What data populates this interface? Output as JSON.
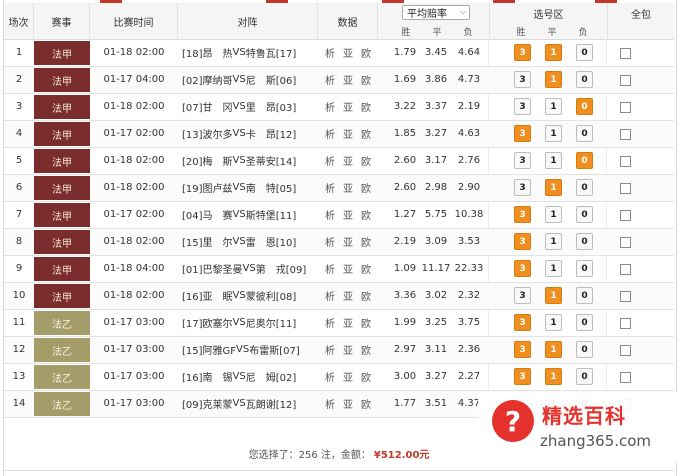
{
  "header": {
    "idx": "场次",
    "league": "赛事",
    "time": "比赛时间",
    "match": "对阵",
    "data": "数据",
    "odds_select": "平均赔率",
    "odds_win": "胜",
    "odds_draw": "平",
    "odds_lose": "负",
    "pick_area": "选号区",
    "pick_win": "胜",
    "pick_draw": "平",
    "pick_lose": "负",
    "all": "全包"
  },
  "links": {
    "analysis": "析",
    "asia": "亚",
    "euro": "欧"
  },
  "colors": {
    "league_jia": "#7b2d2d",
    "league_yi": "#a59d69",
    "selected": "#ef8f1f"
  },
  "rows": [
    {
      "idx": "1",
      "league": "法甲",
      "time": "01-18 02:00",
      "home": "[18]昂　热",
      "vs": "VS",
      "away": "特鲁瓦[17]",
      "w": "1.79",
      "d": "3.45",
      "l": "4.64",
      "sel": [
        1,
        1,
        0
      ],
      "type": "jia"
    },
    {
      "idx": "2",
      "league": "法甲",
      "time": "01-17 04:00",
      "home": "[02]摩纳哥",
      "vs": "VS",
      "away": "尼　斯[06]",
      "w": "1.69",
      "d": "3.86",
      "l": "4.73",
      "sel": [
        0,
        1,
        0
      ],
      "type": "jia"
    },
    {
      "idx": "3",
      "league": "法甲",
      "time": "01-18 02:00",
      "home": "[07]甘　冈",
      "vs": "VS",
      "away": "里　昂[03]",
      "w": "3.22",
      "d": "3.37",
      "l": "2.19",
      "sel": [
        0,
        0,
        1
      ],
      "type": "jia"
    },
    {
      "idx": "4",
      "league": "法甲",
      "time": "01-17 02:00",
      "home": "[13]波尔多",
      "vs": "VS",
      "away": "卡　昂[12]",
      "w": "1.85",
      "d": "3.27",
      "l": "4.63",
      "sel": [
        1,
        0,
        0
      ],
      "type": "jia"
    },
    {
      "idx": "5",
      "league": "法甲",
      "time": "01-18 02:00",
      "home": "[20]梅　斯",
      "vs": "VS",
      "away": "圣蒂安[14]",
      "w": "2.60",
      "d": "3.17",
      "l": "2.76",
      "sel": [
        0,
        0,
        1
      ],
      "type": "jia"
    },
    {
      "idx": "6",
      "league": "法甲",
      "time": "01-18 02:00",
      "home": "[19]图卢兹",
      "vs": "VS",
      "away": "南　特[05]",
      "w": "2.60",
      "d": "2.98",
      "l": "2.90",
      "sel": [
        0,
        1,
        0
      ],
      "type": "jia"
    },
    {
      "idx": "7",
      "league": "法甲",
      "time": "01-17 02:00",
      "home": "[04]马　赛",
      "vs": "VS",
      "away": "斯特堡[11]",
      "w": "1.27",
      "d": "5.75",
      "l": "10.38",
      "sel": [
        1,
        0,
        0
      ],
      "type": "jia"
    },
    {
      "idx": "8",
      "league": "法甲",
      "time": "01-18 02:00",
      "home": "[15]里　尔",
      "vs": "VS",
      "away": "雷　恩[10]",
      "w": "2.19",
      "d": "3.09",
      "l": "3.53",
      "sel": [
        1,
        0,
        0
      ],
      "type": "jia"
    },
    {
      "idx": "9",
      "league": "法甲",
      "time": "01-18 04:00",
      "home": "[01]巴黎圣曼",
      "vs": "VS",
      "away": "第　戎[09]",
      "w": "1.09",
      "d": "11.17",
      "l": "22.33",
      "sel": [
        1,
        0,
        0
      ],
      "type": "jia"
    },
    {
      "idx": "10",
      "league": "法甲",
      "time": "01-18 02:00",
      "home": "[16]亚　眠",
      "vs": "VS",
      "away": "蒙彼利[08]",
      "w": "3.36",
      "d": "3.02",
      "l": "2.32",
      "sel": [
        0,
        1,
        0
      ],
      "type": "jia"
    },
    {
      "idx": "11",
      "league": "法乙",
      "time": "01-17 03:00",
      "home": "[17]欧塞尔",
      "vs": "VS",
      "away": "尼奥尔[11]",
      "w": "1.99",
      "d": "3.25",
      "l": "3.75",
      "sel": [
        1,
        0,
        0
      ],
      "type": "yi"
    },
    {
      "idx": "12",
      "league": "法乙",
      "time": "01-17 03:00",
      "home": "[15]阿雅GF",
      "vs": "VS",
      "away": "布雷斯[07]",
      "w": "2.97",
      "d": "3.11",
      "l": "2.36",
      "sel": [
        1,
        1,
        0
      ],
      "type": "yi"
    },
    {
      "idx": "13",
      "league": "法乙",
      "time": "01-17 03:00",
      "home": "[16]南　锡",
      "vs": "VS",
      "away": "尼　姆[02]",
      "w": "3.00",
      "d": "3.27",
      "l": "2.27",
      "sel": [
        1,
        1,
        0
      ],
      "type": "yi"
    },
    {
      "idx": "14",
      "league": "法乙",
      "time": "01-17 03:00",
      "home": "[09]克莱蒙",
      "vs": "VS",
      "away": "瓦朗谢[12]",
      "w": "1.77",
      "d": "3.51",
      "l": "4.37",
      "sel": [
        0,
        0,
        0
      ],
      "type": "yi"
    }
  ],
  "pick_labels": [
    "3",
    "1",
    "0"
  ],
  "footer": {
    "text": "您选择了：256 注，金额：",
    "amount": "¥512.00元"
  },
  "watermark": {
    "symbol": "?",
    "title": "精选百科",
    "url": "zhang365.com"
  }
}
